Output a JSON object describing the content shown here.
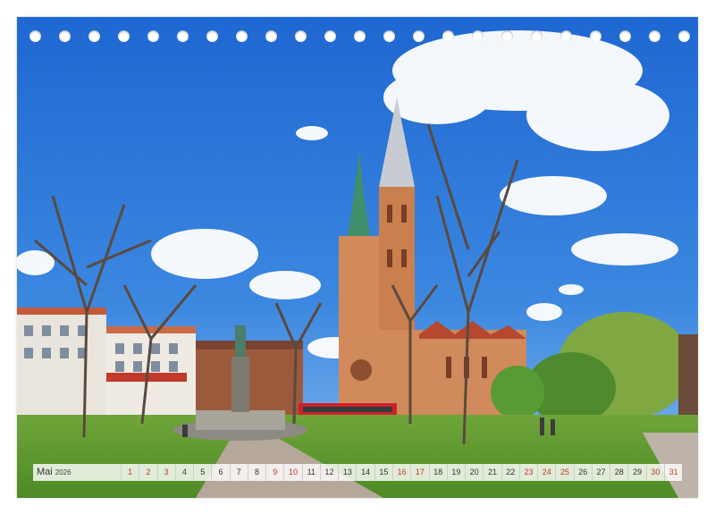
{
  "calendar": {
    "month": "Mai",
    "year": "2026",
    "days": [
      "1",
      "2",
      "3",
      "4",
      "5",
      "6",
      "7",
      "8",
      "9",
      "10",
      "11",
      "12",
      "13",
      "14",
      "15",
      "16",
      "17",
      "18",
      "19",
      "20",
      "21",
      "22",
      "23",
      "24",
      "25",
      "26",
      "27",
      "28",
      "29",
      "30",
      "31"
    ],
    "weekend_days": [
      "1",
      "2",
      "3",
      "9",
      "10",
      "16",
      "17",
      "23",
      "24",
      "25",
      "30",
      "31"
    ],
    "accent_weekend_color": "#c0392b"
  },
  "photo": {
    "subject": "church-with-two-towers-and-fountain",
    "sky_color": "#2f78d8",
    "grass_color": "#5e9a2e"
  }
}
